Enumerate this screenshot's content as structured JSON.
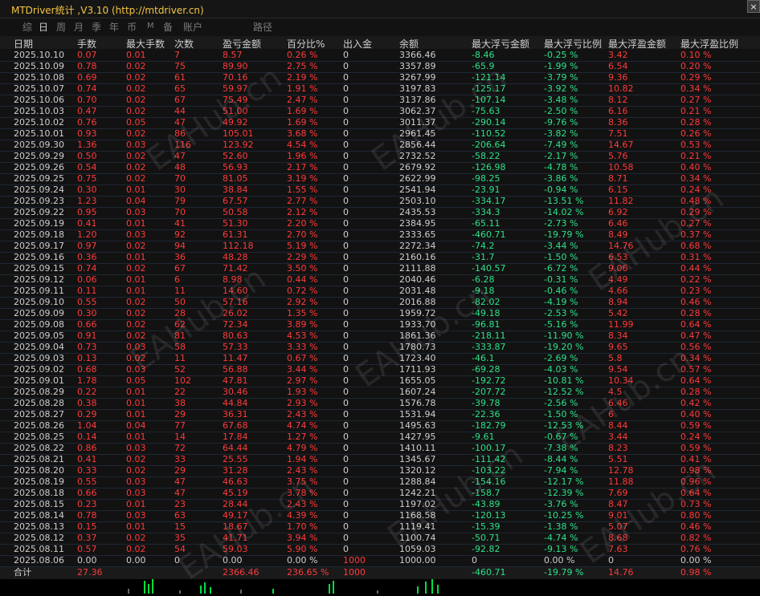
{
  "title": "MTDriver统计 ,V3.10 (http://mtdriver.cn)",
  "close_label": "×",
  "tabs": [
    "综",
    "日",
    "周",
    "月",
    "季",
    "年",
    "币",
    "M",
    "备",
    "账户",
    "路径"
  ],
  "active_tab": "日",
  "headers": [
    "日期",
    "手数",
    "最大手数",
    "次数",
    "盈亏金额",
    "百分比%",
    "出入金",
    "余额",
    "最大浮亏金额",
    "最大浮亏比例",
    "最大浮盈金额",
    "最大浮盈比例"
  ],
  "rows": [
    [
      "2025.10.10",
      "0.07",
      "0.01",
      "7",
      "8.57",
      "0.26 %",
      "0",
      "3366.46",
      "-8.46",
      "-0.25 %",
      "3.42",
      "0.10 %"
    ],
    [
      "2025.10.09",
      "0.78",
      "0.02",
      "75",
      "89.90",
      "2.75 %",
      "0",
      "3357.89",
      "-65.9",
      "-1.99 %",
      "6.54",
      "0.20 %"
    ],
    [
      "2025.10.08",
      "0.69",
      "0.02",
      "61",
      "70.16",
      "2.19 %",
      "0",
      "3267.99",
      "-121.14",
      "-3.79 %",
      "9.36",
      "0.29 %"
    ],
    [
      "2025.10.07",
      "0.74",
      "0.02",
      "65",
      "59.97",
      "1.91 %",
      "0",
      "3197.83",
      "-125.17",
      "-3.92 %",
      "10.82",
      "0.34 %"
    ],
    [
      "2025.10.06",
      "0.70",
      "0.02",
      "67",
      "75.49",
      "2.47 %",
      "0",
      "3137.86",
      "-107.14",
      "-3.48 %",
      "8.12",
      "0.27 %"
    ],
    [
      "2025.10.03",
      "0.47",
      "0.02",
      "44",
      "51.00",
      "1.69 %",
      "0",
      "3062.37",
      "-75.63",
      "-2.50 %",
      "6.16",
      "0.21 %"
    ],
    [
      "2025.10.02",
      "0.76",
      "0.05",
      "47",
      "49.92",
      "1.69 %",
      "0",
      "3011.37",
      "-290.14",
      "-9.76 %",
      "8.36",
      "0.28 %"
    ],
    [
      "2025.10.01",
      "0.93",
      "0.02",
      "86",
      "105.01",
      "3.68 %",
      "0",
      "2961.45",
      "-110.52",
      "-3.82 %",
      "7.51",
      "0.26 %"
    ],
    [
      "2025.09.30",
      "1.36",
      "0.03",
      "116",
      "123.92",
      "4.54 %",
      "0",
      "2856.44",
      "-206.64",
      "-7.49 %",
      "14.67",
      "0.53 %"
    ],
    [
      "2025.09.29",
      "0.50",
      "0.02",
      "47",
      "52.60",
      "1.96 %",
      "0",
      "2732.52",
      "-58.22",
      "-2.17 %",
      "5.76",
      "0.21 %"
    ],
    [
      "2025.09.26",
      "0.54",
      "0.02",
      "48",
      "56.93",
      "2.17 %",
      "0",
      "2679.92",
      "-126.98",
      "-4.78 %",
      "10.58",
      "0.40 %"
    ],
    [
      "2025.09.25",
      "0.75",
      "0.02",
      "70",
      "81.05",
      "3.19 %",
      "0",
      "2622.99",
      "-98.25",
      "-3.86 %",
      "8.71",
      "0.34 %"
    ],
    [
      "2025.09.24",
      "0.30",
      "0.01",
      "30",
      "38.84",
      "1.55 %",
      "0",
      "2541.94",
      "-23.91",
      "-0.94 %",
      "6.15",
      "0.24 %"
    ],
    [
      "2025.09.23",
      "1.23",
      "0.04",
      "79",
      "67.57",
      "2.77 %",
      "0",
      "2503.10",
      "-334.17",
      "-13.51 %",
      "11.82",
      "0.48 %"
    ],
    [
      "2025.09.22",
      "0.95",
      "0.03",
      "70",
      "50.58",
      "2.12 %",
      "0",
      "2435.53",
      "-334.3",
      "-14.02 %",
      "6.92",
      "0.29 %"
    ],
    [
      "2025.09.19",
      "0.41",
      "0.01",
      "41",
      "51.30",
      "2.20 %",
      "0",
      "2384.95",
      "-65.11",
      "-2.73 %",
      "6.46",
      "0.27 %"
    ],
    [
      "2025.09.18",
      "1.20",
      "0.03",
      "92",
      "61.31",
      "2.70 %",
      "0",
      "2333.65",
      "-460.71",
      "-19.79 %",
      "8.49",
      "0.37 %"
    ],
    [
      "2025.09.17",
      "0.97",
      "0.02",
      "94",
      "112.18",
      "5.19 %",
      "0",
      "2272.34",
      "-74.2",
      "-3.44 %",
      "14.76",
      "0.68 %"
    ],
    [
      "2025.09.16",
      "0.36",
      "0.01",
      "36",
      "48.28",
      "2.29 %",
      "0",
      "2160.16",
      "-31.7",
      "-1.50 %",
      "6.53",
      "0.31 %"
    ],
    [
      "2025.09.15",
      "0.74",
      "0.02",
      "67",
      "71.42",
      "3.50 %",
      "0",
      "2111.88",
      "-140.57",
      "-6.72 %",
      "9.06",
      "0.44 %"
    ],
    [
      "2025.09.12",
      "0.06",
      "0.01",
      "6",
      "8.98",
      "0.44 %",
      "0",
      "2040.46",
      "-6.28",
      "-0.31 %",
      "4.49",
      "0.22 %"
    ],
    [
      "2025.09.11",
      "0.11",
      "0.01",
      "11",
      "14.60",
      "0.72 %",
      "0",
      "2031.48",
      "-9.18",
      "-0.46 %",
      "4.66",
      "0.23 %"
    ],
    [
      "2025.09.10",
      "0.55",
      "0.02",
      "50",
      "57.16",
      "2.92 %",
      "0",
      "2016.88",
      "-82.02",
      "-4.19 %",
      "8.94",
      "0.46 %"
    ],
    [
      "2025.09.09",
      "0.30",
      "0.02",
      "28",
      "26.02",
      "1.35 %",
      "0",
      "1959.72",
      "-49.18",
      "-2.53 %",
      "5.42",
      "0.28 %"
    ],
    [
      "2025.09.08",
      "0.66",
      "0.02",
      "62",
      "72.34",
      "3.89 %",
      "0",
      "1933.70",
      "-96.81",
      "-5.16 %",
      "11.99",
      "0.64 %"
    ],
    [
      "2025.09.05",
      "0.91",
      "0.02",
      "81",
      "80.63",
      "4.53 %",
      "0",
      "1861.36",
      "-218.11",
      "-11.90 %",
      "8.34",
      "0.47 %"
    ],
    [
      "2025.09.04",
      "0.73",
      "0.03",
      "58",
      "57.33",
      "3.33 %",
      "0",
      "1780.73",
      "-333.87",
      "-19.20 %",
      "9.65",
      "0.56 %"
    ],
    [
      "2025.09.03",
      "0.13",
      "0.02",
      "11",
      "11.47",
      "0.67 %",
      "0",
      "1723.40",
      "-46.1",
      "-2.69 %",
      "5.8",
      "0.34 %"
    ],
    [
      "2025.09.02",
      "0.68",
      "0.03",
      "52",
      "56.88",
      "3.44 %",
      "0",
      "1711.93",
      "-69.28",
      "-4.03 %",
      "9.54",
      "0.57 %"
    ],
    [
      "2025.09.01",
      "1.78",
      "0.05",
      "102",
      "47.81",
      "2.97 %",
      "0",
      "1655.05",
      "-192.72",
      "-10.81 %",
      "10.34",
      "0.64 %"
    ],
    [
      "2025.08.29",
      "0.22",
      "0.01",
      "22",
      "30.46",
      "1.93 %",
      "0",
      "1607.24",
      "-207.72",
      "-12.52 %",
      "4.5",
      "0.28 %"
    ],
    [
      "2025.08.28",
      "0.38",
      "0.01",
      "38",
      "44.84",
      "2.93 %",
      "0",
      "1576.78",
      "-39.78",
      "-2.56 %",
      "6.46",
      "0.42 %"
    ],
    [
      "2025.08.27",
      "0.29",
      "0.01",
      "29",
      "36.31",
      "2.43 %",
      "0",
      "1531.94",
      "-22.36",
      "-1.50 %",
      "6",
      "0.40 %"
    ],
    [
      "2025.08.26",
      "1.04",
      "0.04",
      "77",
      "67.68",
      "4.74 %",
      "0",
      "1495.63",
      "-182.79",
      "-12.53 %",
      "8.44",
      "0.59 %"
    ],
    [
      "2025.08.25",
      "0.14",
      "0.01",
      "14",
      "17.84",
      "1.27 %",
      "0",
      "1427.95",
      "-9.61",
      "-0.67 %",
      "3.44",
      "0.24 %"
    ],
    [
      "2025.08.22",
      "0.86",
      "0.03",
      "72",
      "64.44",
      "4.79 %",
      "0",
      "1410.11",
      "-100.17",
      "-7.38 %",
      "8.23",
      "0.59 %"
    ],
    [
      "2025.08.21",
      "0.41",
      "0.02",
      "33",
      "25.55",
      "1.94 %",
      "0",
      "1345.67",
      "-111.42",
      "-8.44 %",
      "5.51",
      "0.41 %"
    ],
    [
      "2025.08.20",
      "0.33",
      "0.02",
      "29",
      "31.28",
      "2.43 %",
      "0",
      "1320.12",
      "-103.22",
      "-7.94 %",
      "12.78",
      "0.98 %"
    ],
    [
      "2025.08.19",
      "0.55",
      "0.03",
      "47",
      "46.63",
      "3.75 %",
      "0",
      "1288.84",
      "-154.16",
      "-12.17 %",
      "11.88",
      "0.96 %"
    ],
    [
      "2025.08.18",
      "0.66",
      "0.03",
      "47",
      "45.19",
      "3.78 %",
      "0",
      "1242.21",
      "-158.7",
      "-12.39 %",
      "7.69",
      "0.64 %"
    ],
    [
      "2025.08.15",
      "0.23",
      "0.01",
      "23",
      "28.44",
      "2.43 %",
      "0",
      "1197.02",
      "-43.89",
      "-3.76 %",
      "8.47",
      "0.73 %"
    ],
    [
      "2025.08.14",
      "0.78",
      "0.03",
      "63",
      "49.17",
      "4.39 %",
      "0",
      "1168.58",
      "-120.13",
      "-10.25 %",
      "9.01",
      "0.80 %"
    ],
    [
      "2025.08.13",
      "0.15",
      "0.01",
      "15",
      "18.67",
      "1.70 %",
      "0",
      "1119.41",
      "-15.39",
      "-1.38 %",
      "5.07",
      "0.46 %"
    ],
    [
      "2025.08.12",
      "0.37",
      "0.02",
      "35",
      "41.71",
      "3.94 %",
      "0",
      "1100.74",
      "-50.71",
      "-4.74 %",
      "8.68",
      "0.82 %"
    ],
    [
      "2025.08.11",
      "0.57",
      "0.02",
      "54",
      "59.03",
      "5.90 %",
      "0",
      "1059.03",
      "-92.82",
      "-9.13 %",
      "7.63",
      "0.76 %"
    ],
    [
      "2025.08.06",
      "0.00",
      "0.00",
      "0",
      "0.00",
      "0.00 %",
      "1000",
      "1000.00",
      "0",
      "0.00 %",
      "0",
      "0.00 %"
    ]
  ],
  "total": [
    "合计",
    "27.36",
    "",
    "",
    "2366.46",
    "236.65 %",
    "1000",
    "",
    "-460.71",
    "-19.79 %",
    "14.76",
    "0.98 %"
  ],
  "watermark_text": "EAHub.cn"
}
